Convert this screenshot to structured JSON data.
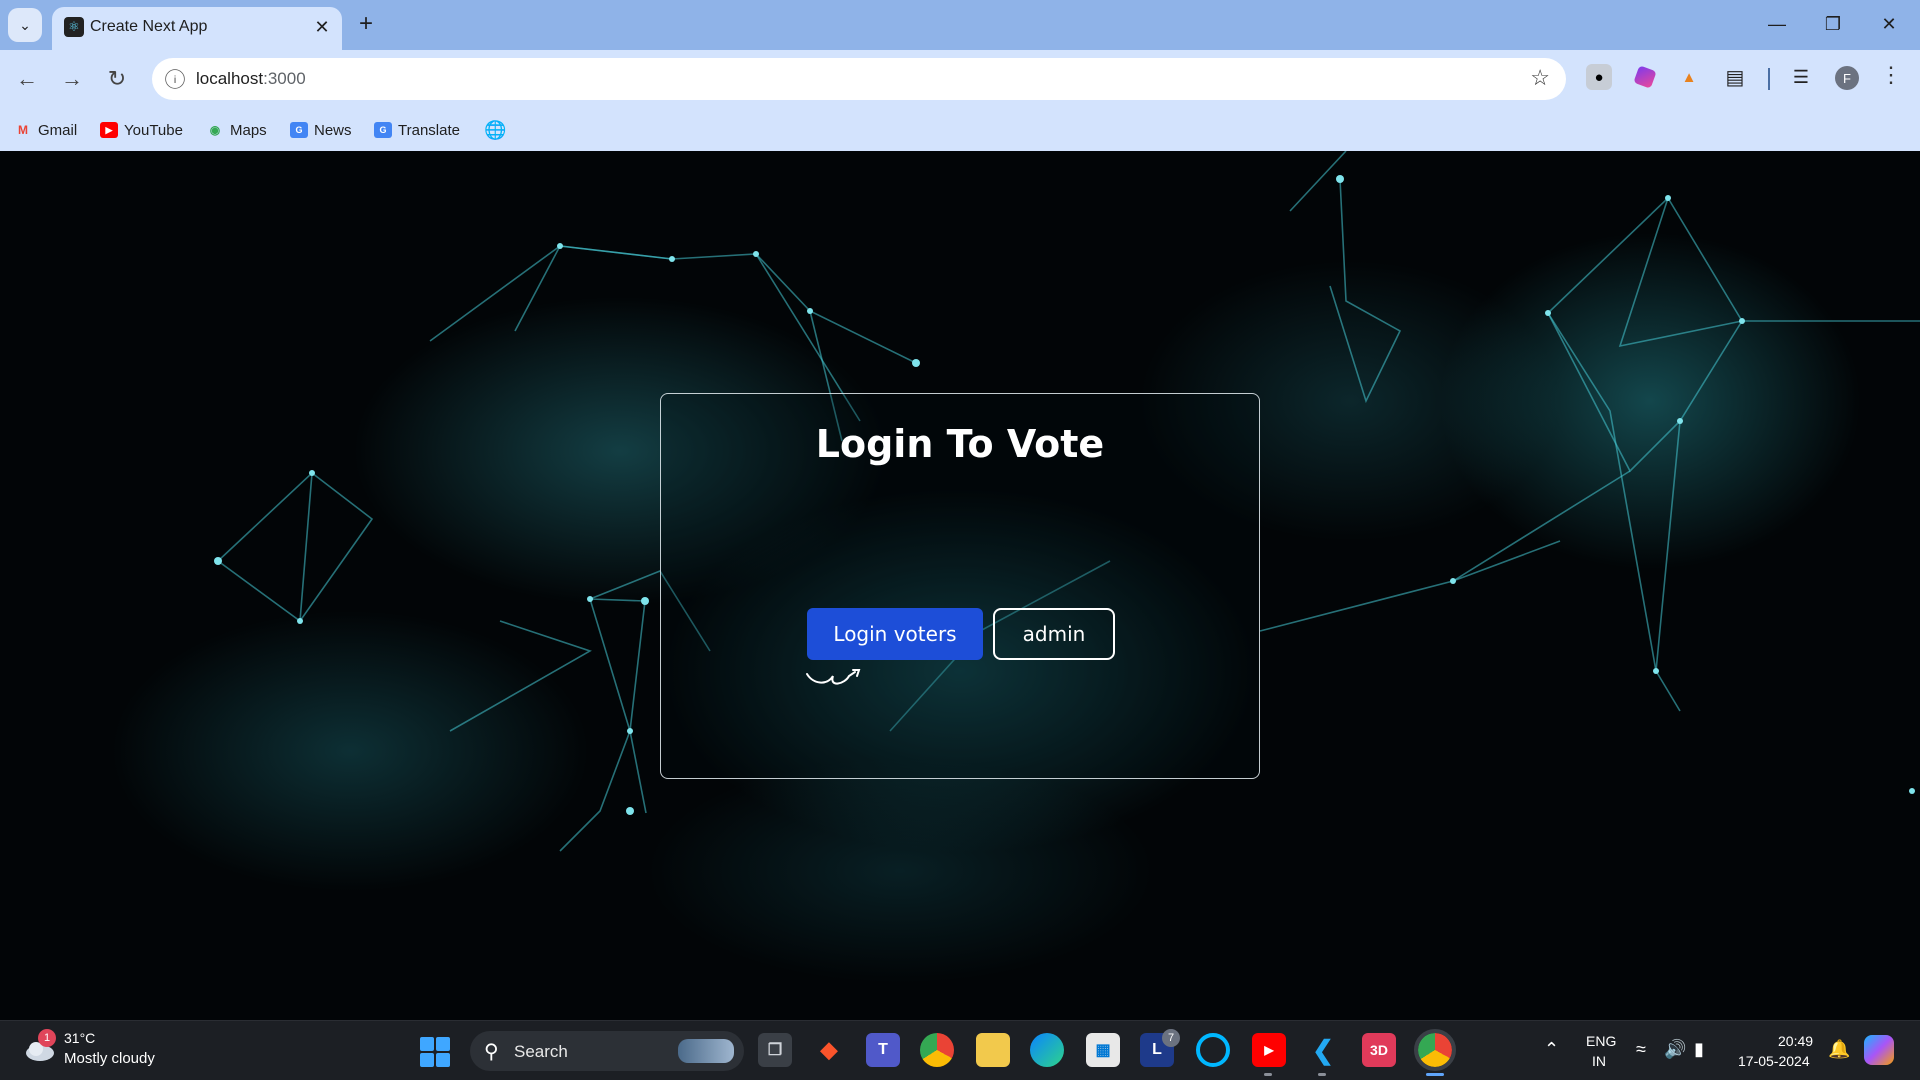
{
  "browser": {
    "tab": {
      "title": "Create Next App"
    },
    "url": {
      "host": "localhost",
      "port": ":3000"
    },
    "bookmarks": [
      {
        "label": "Gmail",
        "icon": "gmail-icon"
      },
      {
        "label": "YouTube",
        "icon": "youtube-icon"
      },
      {
        "label": "Maps",
        "icon": "maps-icon"
      },
      {
        "label": "News",
        "icon": "news-icon"
      },
      {
        "label": "Translate",
        "icon": "translate-icon"
      }
    ],
    "profile_initial": "F"
  },
  "page": {
    "title": "Login To Vote",
    "login_voters_label": "Login voters",
    "admin_label": "admin",
    "colors": {
      "primary_button": "#1d4ed8",
      "background": "#020507",
      "accent": "#3ec6d0"
    }
  },
  "taskbar": {
    "weather": {
      "temp": "31°C",
      "condition": "Mostly cloudy",
      "badge": "1"
    },
    "search_label": "Search",
    "lang": {
      "line1": "ENG",
      "line2": "IN"
    },
    "clock": {
      "time": "20:49",
      "date": "17-05-2024"
    },
    "app_badges": {
      "lock": "7"
    }
  }
}
